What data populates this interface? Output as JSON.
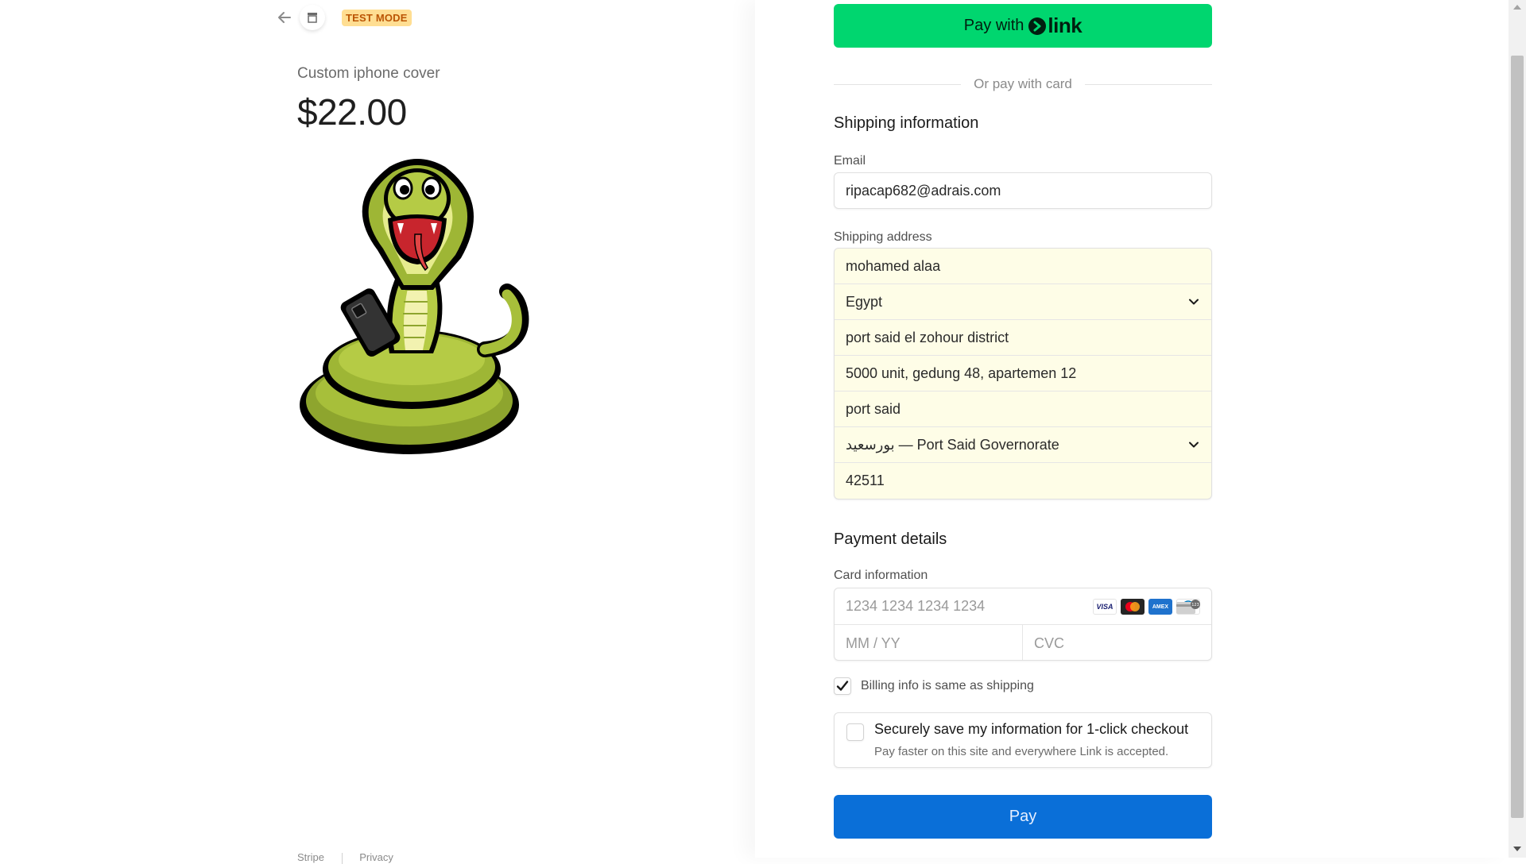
{
  "header": {
    "test_mode_label": "TEST MODE"
  },
  "product": {
    "name": "Custom iphone cover",
    "price": "$22.00"
  },
  "footer": {
    "links": [
      "Stripe",
      "Privacy"
    ]
  },
  "express": {
    "pay_with_label": "Pay with",
    "link_label": "link",
    "divider_text": "Or pay with card"
  },
  "shipping": {
    "section_title": "Shipping information",
    "email_label": "Email",
    "email_value": "ripacap682@adrais.com",
    "address_label": "Shipping address",
    "name": "mohamed alaa",
    "country": "Egypt",
    "address_line1": "port said el zohour district",
    "address_line2": "5000 unit, gedung 48, apartemen 12",
    "city": "port said",
    "state": "بورسعيد — Port Said Governorate",
    "postal_code": "42511"
  },
  "payment": {
    "section_title": "Payment details",
    "card_label": "Card information",
    "card_number_placeholder": "1234 1234 1234 1234",
    "expiry_placeholder": "MM / YY",
    "cvc_placeholder": "CVC",
    "card_brands": [
      "VISA",
      "mastercard",
      "amex",
      "diners"
    ],
    "billing_same_label": "Billing info is same as shipping",
    "billing_same_checked": true,
    "save_title": "Securely save my information for 1-click checkout",
    "save_subtitle": "Pay faster on this site and everywhere Link is accepted.",
    "save_checked": false,
    "pay_button_label": "Pay"
  },
  "colors": {
    "link_green": "#00d66f",
    "pay_blue": "#0a6fd8",
    "autofill_yellow": "#fefde7",
    "test_badge_bg": "#ffde92",
    "test_badge_text": "#bb5504"
  }
}
